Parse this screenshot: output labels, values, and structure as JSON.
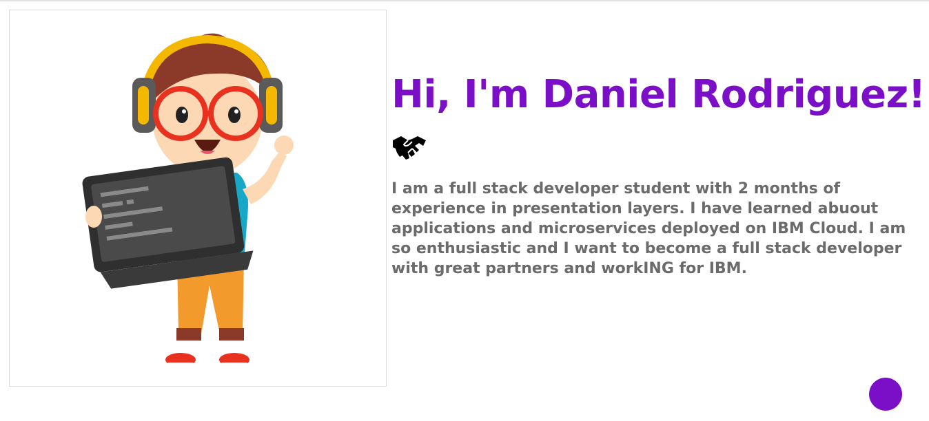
{
  "profile": {
    "greeting": "Hi, I'm Daniel Rodriguez!",
    "greeting_icon": "handshake-icon",
    "bio": "I am a full stack developer student with 2 months of experience in presentation layers. I have learned abuout applications and microservices deployed on IBM Cloud. I am so enthusiastic and I want to become a full stack developer with great partners and workING for IBM."
  },
  "illustration": {
    "subject": "cartoon-kid-with-headphones-holding-laptop"
  },
  "colors": {
    "accent": "#7b0fc7",
    "body_text": "#6b6b6b",
    "background": "#ffffff"
  },
  "fab": {
    "icon": "circle-button"
  }
}
